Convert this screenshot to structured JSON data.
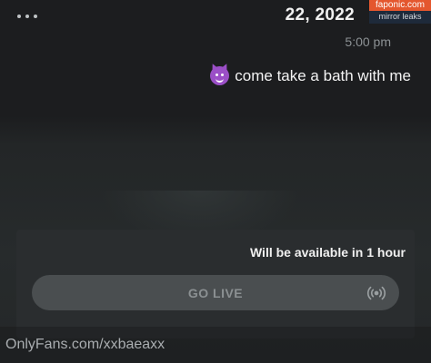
{
  "header": {
    "date": "22, 2022",
    "time": "5:00 pm",
    "more_icon": "more-horizontal-icon"
  },
  "badge": {
    "brand": "faponic.com",
    "tag": "mirror leaks"
  },
  "message": {
    "text": "come take a bath with me",
    "emoji_icon": "smiling-devil-icon"
  },
  "live": {
    "availability": "Will be available in 1 hour",
    "button_label": "GO LIVE",
    "icon": "broadcast-icon"
  },
  "watermark": {
    "text": "OnlyFans.com/xxbaeaxx"
  },
  "colors": {
    "background": "#1c1d1f",
    "card": "#2a2d2f",
    "button": "#4a4e50",
    "badge_brand": "#e4572e"
  }
}
